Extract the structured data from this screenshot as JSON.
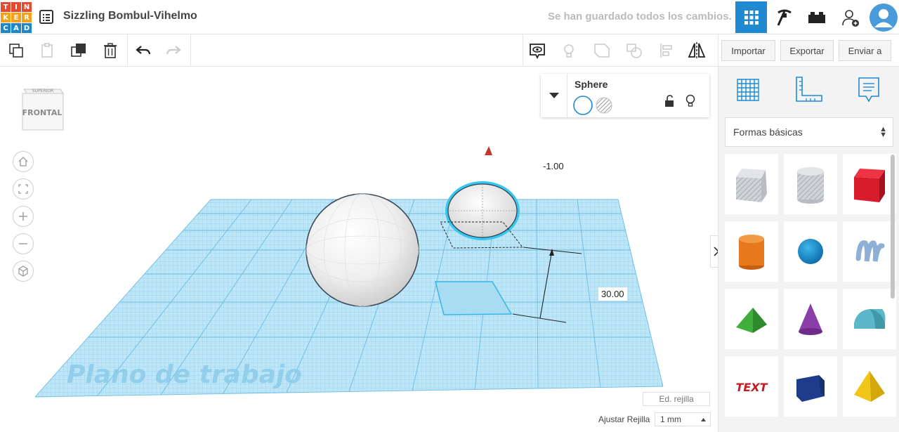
{
  "app": {
    "logo_letters": [
      "T",
      "I",
      "N",
      "K",
      "E",
      "R",
      "C",
      "A",
      "D"
    ],
    "project_title": "Sizzling Bombul-Vihelmo",
    "save_status": "Se han guardado todos los cambios."
  },
  "header_icons": [
    "3d-design-view-icon",
    "codeblocks-pickaxe-icon",
    "bricks-icon",
    "add-user-icon",
    "user-avatar-icon"
  ],
  "toolbar": {
    "import_label": "Importar",
    "export_label": "Exportar",
    "send_label": "Enviar a"
  },
  "viewcube": {
    "top_label": "SUPERIOR",
    "front_label": "FRONTAL"
  },
  "shape_inspector": {
    "name": "Sphere",
    "solid_label": "",
    "hole_label": ""
  },
  "dimensions": {
    "elevation": "-1.00",
    "height": "30.00"
  },
  "workplane": {
    "label": "Plano de trabajo",
    "edit_grid_label": "Ed. rejilla",
    "snap_label": "Ajustar Rejilla",
    "snap_value": "1 mm"
  },
  "side_panel": {
    "category": "Formas básicas",
    "shapes": [
      "box-hole-icon",
      "cylinder-hole-icon",
      "box-icon",
      "cylinder-icon",
      "sphere-icon",
      "scribble-icon",
      "roof-icon",
      "cone-icon",
      "round-roof-icon",
      "text-icon",
      "polygon-icon",
      "pyramid-icon"
    ],
    "text_shape_label": "TEXT"
  },
  "colors": {
    "accent": "#1f8ad1",
    "workplane": "#9fd8f2",
    "selection": "#35c7f0"
  }
}
